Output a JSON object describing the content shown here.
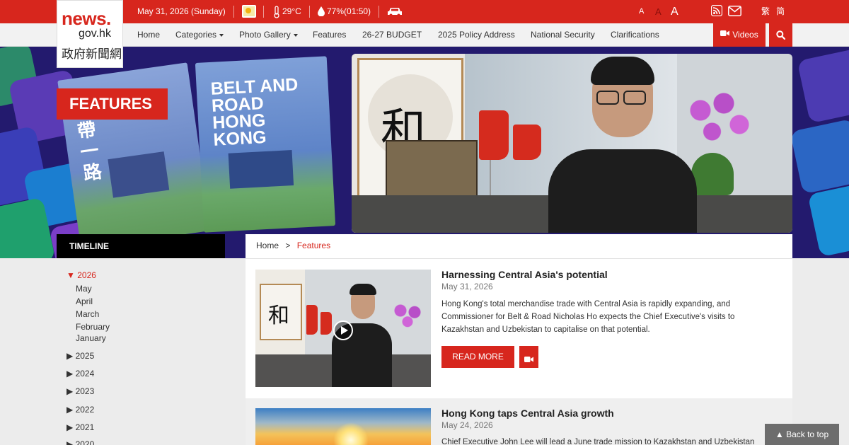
{
  "topbar": {
    "date": "May 31, 2026 (Sunday)",
    "temperature": "29°C",
    "humidity": "77%(01:50)",
    "font_small": "A",
    "font_medium": "A",
    "font_large": "A",
    "lang_trad": "繁",
    "lang_simp": "简",
    "icons": [
      "weather-icon",
      "thermometer-icon",
      "humidity-icon",
      "traffic-car-icon",
      "rss-icon",
      "email-icon"
    ]
  },
  "logo": {
    "line1": "news.",
    "line2": "gov.hk",
    "line3": "政府新聞網"
  },
  "nav": {
    "items": [
      "Home",
      "Categories",
      "Photo Gallery",
      "Features",
      "26-27 BUDGET",
      "2025 Policy Address",
      "National Security",
      "Clarifications"
    ],
    "videos": "Videos"
  },
  "banner": {
    "label": "FEATURES",
    "book_title": "BELT AND ROAD HONG KONG",
    "calligraphy": "和"
  },
  "sidebar": {
    "heading": "TIMELINE",
    "active_year": "2026",
    "months": [
      "May",
      "April",
      "March",
      "February",
      "January"
    ],
    "years": [
      "2025",
      "2024",
      "2023",
      "2022",
      "2021",
      "2020"
    ]
  },
  "breadcrumb": {
    "home": "Home",
    "separator": ">",
    "current": "Features"
  },
  "articles": [
    {
      "title": "Harnessing Central Asia's potential",
      "date": "May 31, 2026",
      "desc": "Hong Kong's total merchandise trade with Central Asia is rapidly expanding, and Commissioner for Belt & Road Nicholas Ho expects the Chief Executive's visits to Kazakhstan and Uzbekistan to capitalise on that potential.",
      "read_more": "READ MORE"
    },
    {
      "title": "Hong Kong taps Central Asia growth",
      "date": "May 24, 2026",
      "desc": "Chief Executive John Lee will lead a June trade mission to Kazakhstan and Uzbekistan"
    }
  ],
  "back_to_top": "▲  Back to top",
  "colors": {
    "brand_red": "#d7261d",
    "banner_navy": "#231a6e"
  }
}
